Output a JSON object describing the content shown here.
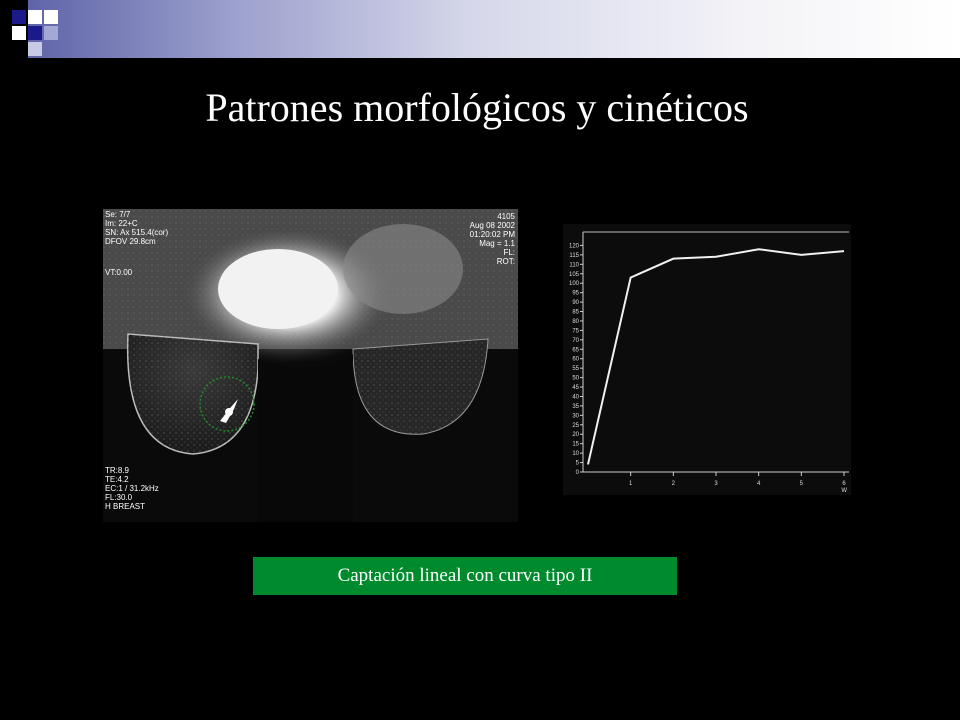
{
  "slide": {
    "title": "Patrones morfológicos y cinéticos",
    "caption": "Captación lineal con curva tipo II",
    "colors": {
      "background": "#000000",
      "caption_box": "#008a2e",
      "title_text": "#ffffff",
      "deco_blue": "#1a1a8a",
      "roi_circle": "#1f8a2a"
    }
  },
  "mri_image": {
    "overlay_left": [
      "Se: 7/7",
      "Im: 22+C",
      "SN: Ax 515.4(cor)",
      "DFOV 29.8cm",
      "",
      "",
      "",
      "",
      "",
      "",
      "TR:8.9",
      "TE:4.2",
      "EC:1 / 31.2kHz",
      "FL:30.0",
      "H BREAST"
    ],
    "overlay_right": [
      "4105",
      "Aug 08 2002",
      "01:20:02 PM",
      "Mag = 1.1",
      "FL:",
      "ROT:"
    ],
    "overlay_topleft_extra": "VT:0.00"
  },
  "curve_plot": {
    "y_ticks": [
      "120",
      "115",
      "110",
      "105",
      "100",
      "95",
      "90",
      "85",
      "80",
      "75",
      "70",
      "65",
      "60",
      "55",
      "50",
      "45",
      "40",
      "35",
      "30",
      "25",
      "20",
      "15",
      "10",
      "5",
      "0"
    ],
    "x_ticks": [
      "1",
      "2",
      "3",
      "4",
      "5",
      "6"
    ],
    "x_unit": "W",
    "curve_values": [
      4,
      103,
      113,
      114,
      118,
      115,
      117
    ],
    "y_max": 125
  }
}
